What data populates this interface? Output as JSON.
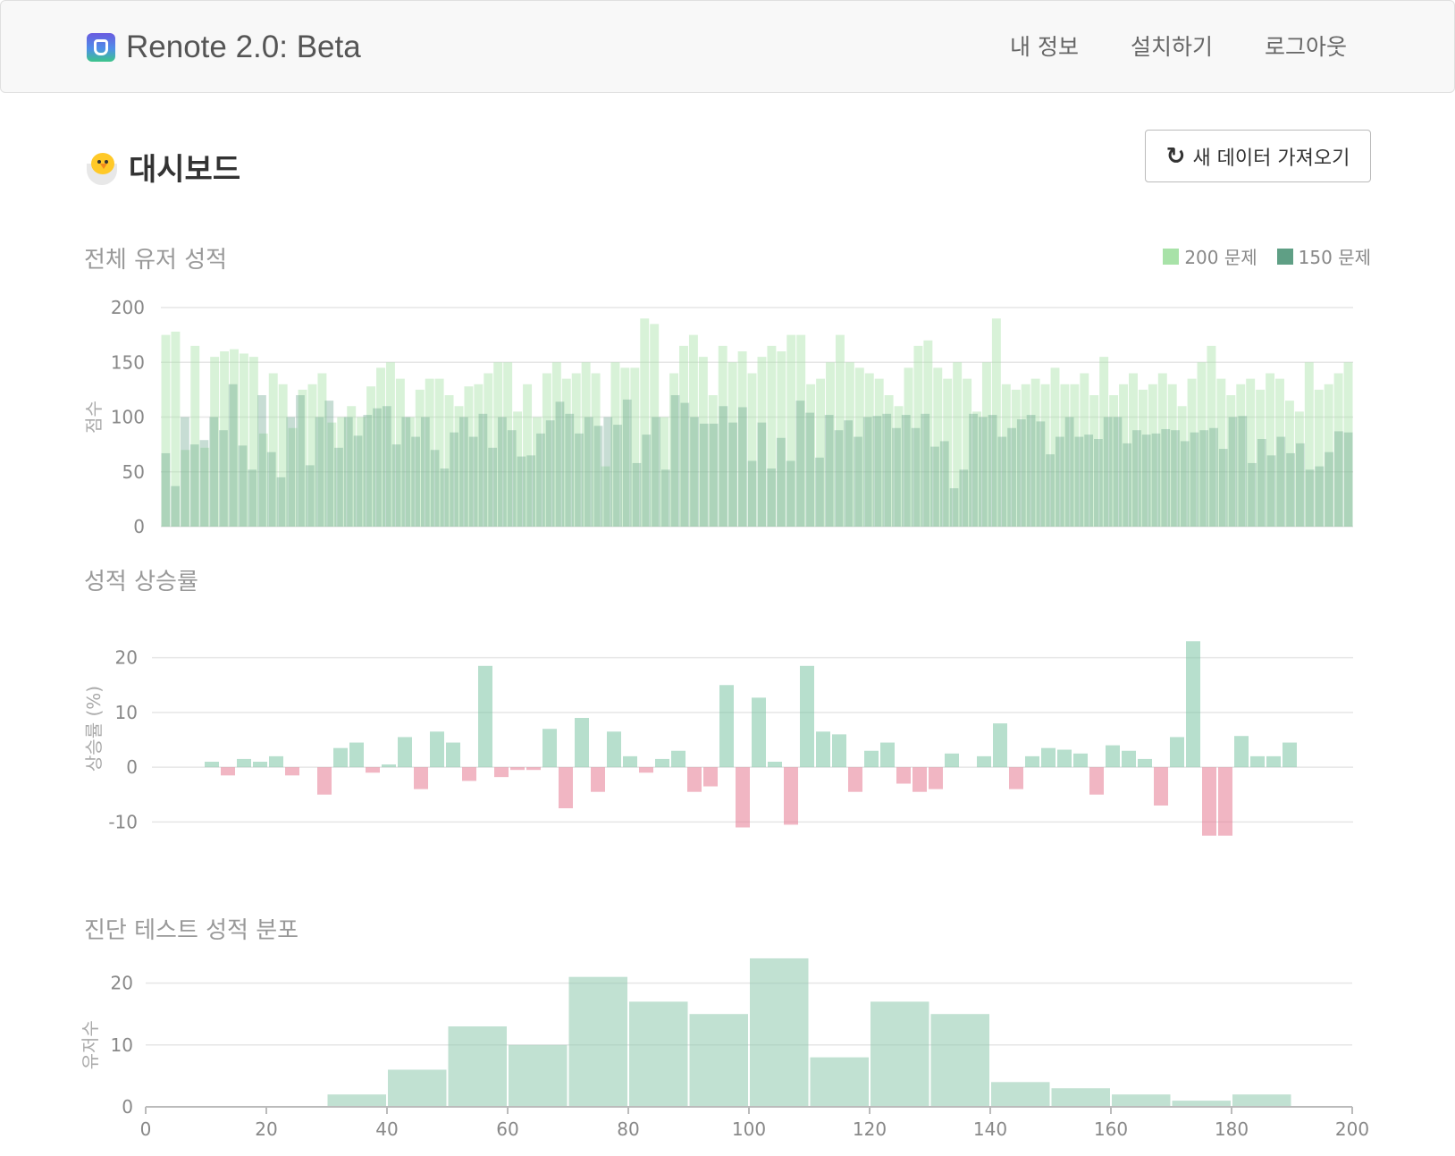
{
  "navbar": {
    "brand": "Renote 2.0: Beta",
    "links": [
      "내 정보",
      "설치하기",
      "로그아웃"
    ]
  },
  "page": {
    "title": "대시보드",
    "refresh_label": "새 데이터 가져오기"
  },
  "colors": {
    "series_200": "#a8e2a8",
    "series_150": "#5f9f85",
    "positive": "#7cc4a4",
    "negative": "#e57a92",
    "histogram": "#8ec8ad"
  },
  "chart_data": [
    {
      "id": "scores",
      "type": "bar",
      "title": "전체 유저 성적",
      "ylabel": "점수",
      "xlabel": "",
      "ylim": [
        0,
        200
      ],
      "yticks": [
        0,
        50,
        100,
        150,
        200
      ],
      "legend_position": "top-right",
      "grid": true,
      "series": [
        {
          "name": "200 문제",
          "values": [
            175,
            178,
            70,
            165,
            72,
            155,
            160,
            162,
            158,
            155,
            85,
            140,
            130,
            90,
            125,
            130,
            140,
            95,
            100,
            110,
            100,
            128,
            145,
            150,
            135,
            100,
            125,
            135,
            135,
            120,
            110,
            128,
            130,
            140,
            150,
            150,
            105,
            130,
            100,
            140,
            150,
            135,
            140,
            150,
            140,
            55,
            150,
            145,
            145,
            190,
            185,
            100,
            140,
            165,
            175,
            155,
            120,
            165,
            150,
            160,
            140,
            155,
            165,
            160,
            175,
            175,
            130,
            135,
            150,
            175,
            150,
            145,
            140,
            135,
            120,
            110,
            145,
            165,
            170,
            145,
            135,
            150,
            135,
            105,
            150,
            190,
            130,
            125,
            130,
            135,
            130,
            145,
            130,
            130,
            140,
            120,
            155,
            120,
            130,
            140,
            125,
            130,
            140,
            130,
            110,
            135,
            150,
            165,
            135,
            120,
            130,
            135,
            125,
            140,
            135,
            115,
            105,
            150,
            125,
            130,
            140,
            150
          ]
        },
        {
          "name": "150 문제",
          "values": [
            67,
            37,
            100,
            75,
            79,
            100,
            88,
            130,
            74,
            52,
            120,
            68,
            45,
            100,
            120,
            56,
            100,
            115,
            72,
            100,
            83,
            102,
            108,
            110,
            75,
            100,
            82,
            100,
            70,
            53,
            86,
            100,
            82,
            103,
            72,
            100,
            88,
            64,
            65,
            85,
            97,
            114,
            103,
            85,
            100,
            92,
            100,
            93,
            116,
            58,
            84,
            100,
            52,
            120,
            113,
            100,
            94,
            94,
            110,
            95,
            109,
            60,
            95,
            53,
            81,
            60,
            115,
            104,
            63,
            102,
            88,
            97,
            82,
            100,
            101,
            103,
            90,
            102,
            90,
            103,
            73,
            78,
            35,
            52,
            103,
            100,
            102,
            82,
            90,
            98,
            102,
            96,
            66,
            82,
            100,
            82,
            84,
            80,
            100,
            100,
            76,
            88,
            84,
            85,
            89,
            88,
            78,
            86,
            88,
            90,
            71,
            100,
            101,
            58,
            80,
            65,
            82,
            67,
            76,
            52,
            55,
            68,
            87,
            86
          ]
        }
      ]
    },
    {
      "id": "growth",
      "type": "bar",
      "title": "성적 상승률",
      "ylabel": "상승률 (%)",
      "xlabel": "",
      "ylim": [
        -15,
        25
      ],
      "yticks": [
        -10,
        0,
        10,
        20
      ],
      "grid": true,
      "values": [
        1,
        -1.5,
        1.5,
        1,
        2,
        -1.5,
        0,
        -5,
        3.5,
        4.5,
        -1,
        0.5,
        5.5,
        -4,
        6.5,
        4.5,
        -2.5,
        18.5,
        -1.8,
        -0.5,
        -0.5,
        7,
        -7.5,
        9,
        -4.5,
        6.5,
        2,
        -1,
        1.5,
        3,
        -4.5,
        -3.5,
        15,
        -11,
        12.7,
        1,
        -10.5,
        18.5,
        6.5,
        6,
        -4.5,
        3,
        4.5,
        -3,
        -4.5,
        -4,
        2.5,
        0,
        2,
        8,
        -4,
        2,
        3.5,
        3.2,
        2.5,
        -5,
        4,
        3,
        1.5,
        -7,
        5.5,
        23,
        -12.5,
        -12.5,
        5.7,
        2,
        2,
        4.5
      ]
    },
    {
      "id": "distribution",
      "type": "bar",
      "title": "진단 테스트 성적 분포",
      "ylabel": "유저수",
      "xlabel": "",
      "ylim": [
        0,
        25
      ],
      "yticks": [
        0,
        10,
        20
      ],
      "xlim": [
        0,
        200
      ],
      "xticks": [
        0,
        20,
        40,
        60,
        80,
        100,
        120,
        140,
        160,
        180,
        200
      ],
      "bin_width": 10,
      "bins": [
        0,
        10,
        20,
        30,
        40,
        50,
        60,
        70,
        80,
        90,
        100,
        110,
        120,
        130,
        140,
        150,
        160,
        170,
        180,
        190
      ],
      "counts": [
        0,
        0,
        0,
        2,
        6,
        13,
        10,
        21,
        17,
        15,
        24,
        8,
        17,
        15,
        4,
        3,
        2,
        1,
        2,
        0
      ]
    }
  ]
}
